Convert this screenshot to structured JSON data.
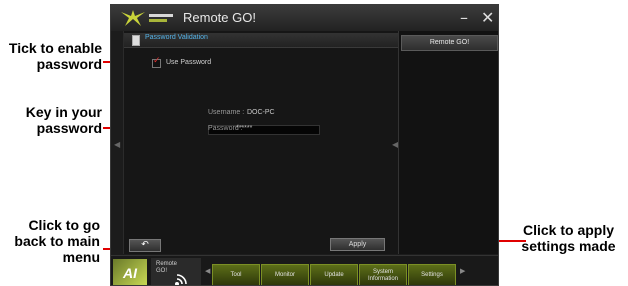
{
  "window": {
    "title": "Remote GO!",
    "minimize_glyph": "–",
    "close_glyph": "✕"
  },
  "panel": {
    "header_label": "Password Validation",
    "use_password_label": "Use Password",
    "use_password_checked": true,
    "checkbox_glyph": "✓",
    "username_label": "Username :",
    "username_value": "DOC-PC",
    "password_label": "Password :",
    "password_value": "******",
    "left_arrow_glyph": "◀"
  },
  "right_panel": {
    "button_label": "Remote GO!",
    "collapse_glyph": "◀"
  },
  "buttons": {
    "back_glyph": "↶",
    "apply_label": "Apply"
  },
  "bottom_bar": {
    "brand_logo": "AI",
    "remote_tile_label": "Remote GO!",
    "left_scroll_glyph": "◀",
    "right_scroll_glyph": "▶",
    "tabs": [
      {
        "label": "Tool"
      },
      {
        "label": "Monitor"
      },
      {
        "label": "Update"
      },
      {
        "label": "System Information"
      },
      {
        "label": "Settings"
      }
    ]
  },
  "annotations": {
    "tick_to_enable": "Tick to enable password",
    "key_in_password": "Key in your password",
    "go_back": "Click to go back to main menu",
    "apply_settings": "Click to apply settings made"
  },
  "colors": {
    "accent_blue": "#55b3e8",
    "leader_red": "#e00000",
    "tab_green": "#5c6e18"
  }
}
